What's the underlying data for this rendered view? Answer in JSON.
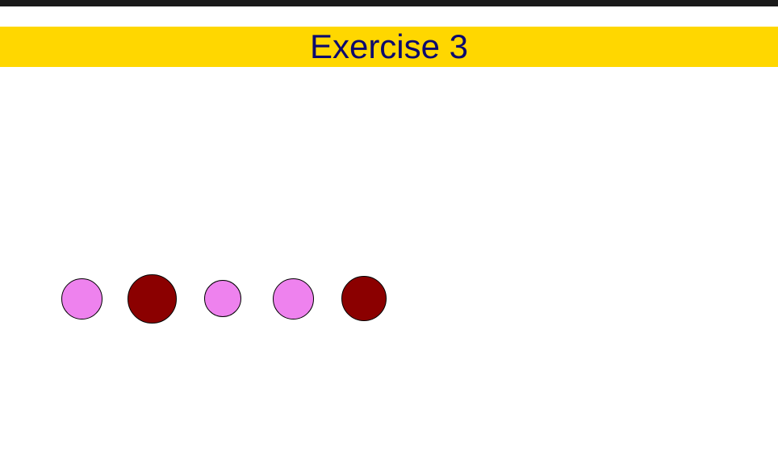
{
  "header": {
    "title": "Exercise 3",
    "band_color": "#ffd700",
    "title_color": "#0c0a6e",
    "top_bar_color": "#1a1a1a"
  },
  "colors": {
    "pink": "#ee82ee",
    "dark_red": "#8b0000",
    "outline": "#000000"
  },
  "circles": [
    {
      "color": "pink"
    },
    {
      "color": "dark_red"
    },
    {
      "color": "pink"
    },
    {
      "color": "pink"
    },
    {
      "color": "dark_red"
    }
  ]
}
